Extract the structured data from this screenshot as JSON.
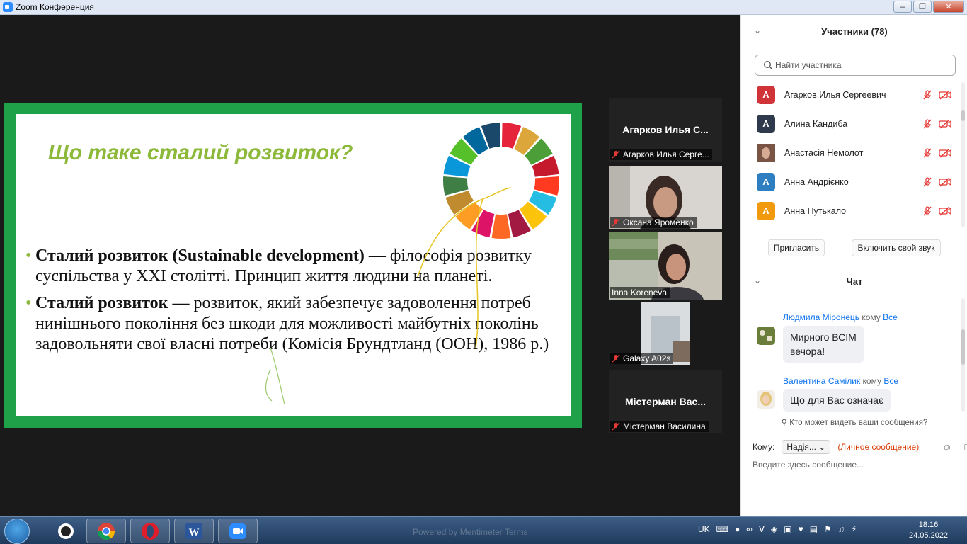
{
  "window": {
    "title": "Zoom Конференция"
  },
  "slide": {
    "title": "Що таке сталий розвиток?",
    "bullets": [
      {
        "bold": "Сталий розвиток (Sustainable development)",
        "rest": " — філософія розвитку суспільства у XXI столітті. Принцип життя людини на планеті."
      },
      {
        "bold": "Сталий розвиток",
        "rest": " — розвиток, який забезпечує задоволення потреб нинішнього покоління без шкоди для можливості майбутніх поколінь задовольняти свої власні потреби (Комісія Брундтланд (ООН), 1986 р.)"
      }
    ],
    "sdg_colors": [
      "#e5243b",
      "#dda63a",
      "#4c9f38",
      "#c5192d",
      "#ff3a21",
      "#26bde2",
      "#fcc30b",
      "#a21942",
      "#fd6925",
      "#dd1367",
      "#fd9d24",
      "#bf8b2e",
      "#3f7e44",
      "#0a97d9",
      "#56c02b",
      "#00689d",
      "#19486a"
    ]
  },
  "tiles": [
    {
      "big_name": "Агарков Илья С...",
      "label": "Агарков Илья Серге..."
    },
    {
      "label": "Оксана  Яроменко"
    },
    {
      "label": "Inna Koreneva"
    },
    {
      "label": "Galaxy A02s"
    },
    {
      "big_name": "Містерман Вас...",
      "label": "Містерман Василина"
    }
  ],
  "participants": {
    "header": "Участники (78)",
    "search_placeholder": "Найти участника",
    "list": [
      {
        "initial": "A",
        "color": "#d13438",
        "name": "Агарков Илья Сергеевич"
      },
      {
        "initial": "A",
        "color": "#2f3b4c",
        "name": "Алина Кандиба"
      },
      {
        "initial": "",
        "color": "#8a6a5a",
        "name": "Анастасія Немолот"
      },
      {
        "initial": "A",
        "color": "#2d7fc1",
        "name": "Анна Андрієнко"
      },
      {
        "initial": "A",
        "color": "#f29a0e",
        "name": "Анна Путькало"
      }
    ],
    "invite_label": "Пригласить",
    "unmute_label": "Включить свой звук"
  },
  "chat": {
    "header": "Чат",
    "messages": [
      {
        "from": "Людмила Міронець",
        "kw": "кому",
        "to": "Все",
        "text_lines": [
          "Мирного ВСІМ",
          "вечора!"
        ]
      },
      {
        "from": "Валентина Самілик",
        "kw": "кому",
        "to": "Все",
        "text_lines": [
          "Що для Вас означає"
        ]
      }
    ],
    "who_can_see": "Кто может видеть ваши сообщения?",
    "to_label": "Кому:",
    "to_value": "Надія...",
    "private_label": "(Личное сообщение)",
    "input_placeholder": "Введите здесь сообщение..."
  },
  "taskbar": {
    "faded_text": "Powered by Mentimeter     Terms",
    "lang": "UK",
    "time": "18:16",
    "date": "24.05.2022"
  }
}
